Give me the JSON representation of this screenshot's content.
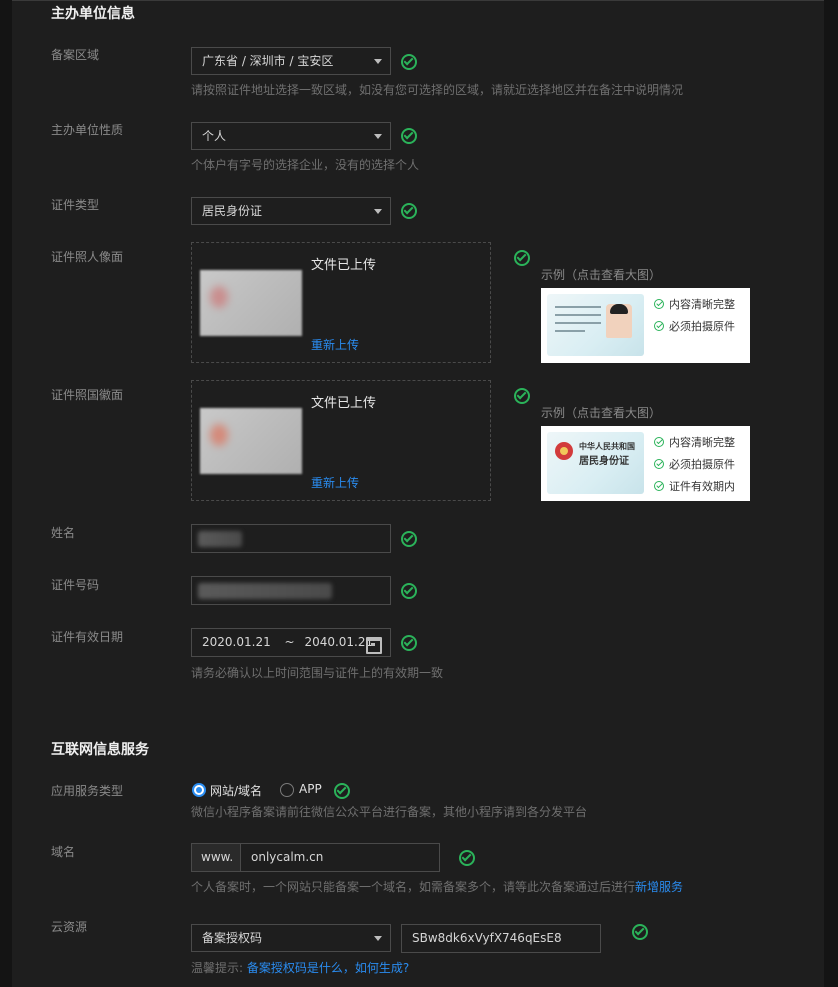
{
  "sections": {
    "sponsor": "主办单位信息",
    "internet": "互联网信息服务"
  },
  "labels": {
    "region": "备案区域",
    "nature": "主办单位性质",
    "cert_type": "证件类型",
    "cert_front": "证件照人像面",
    "cert_back": "证件照国徽面",
    "name": "姓名",
    "cert_no": "证件号码",
    "validity": "证件有效日期",
    "service_type": "应用服务类型",
    "domain": "域名",
    "cloud": "云资源"
  },
  "fields": {
    "region_value": "广东省 / 深圳市 / 宝安区",
    "region_hint": "请按照证件地址选择一致区域，如没有您可选择的区域，请就近选择地区并在备注中说明情况",
    "nature_value": "个人",
    "nature_hint": "个体户有字号的选择企业，没有的选择个人",
    "cert_type_value": "居民身份证",
    "date_start": "2020.01.21",
    "date_sep": "~",
    "date_end": "2040.01.21",
    "date_hint": "请务必确认以上时间范围与证件上的有效期一致",
    "service_options": [
      "网站/域名",
      "APP"
    ],
    "service_selected": "网站/域名",
    "service_hint": "微信小程序备案请前往微信公众平台进行备案，其他小程序请到各分发平台",
    "domain_prefix": "www.",
    "domain_value": "onlycalm.cn",
    "domain_hint": "个人备案时，一个网站只能备案一个域名，如需备案多个，请等此次备案通过后进行",
    "domain_hint_link": "新增服务",
    "cloud_type": "备案授权码",
    "cloud_code": "SBw8dk6xVyfX746qEsE8",
    "cloud_hint_prefix": "温馨提示:",
    "cloud_hint_link": "备案授权码是什么，如何生成?"
  },
  "uploads": {
    "status": "文件已上传",
    "reupload": "重新上传"
  },
  "examples": {
    "caption": "示例（点击查看大图）",
    "front_items": [
      "内容清晰完整",
      "必须拍摄原件"
    ],
    "back_items": [
      "内容清晰完整",
      "必须拍摄原件",
      "证件有效期内"
    ],
    "back_card_title": "中华人民共和国",
    "back_card_subtitle": "居民身份证"
  },
  "colors": {
    "background": "#1e1e1e",
    "accent": "#2a8cf0",
    "success": "#2bb35a"
  }
}
